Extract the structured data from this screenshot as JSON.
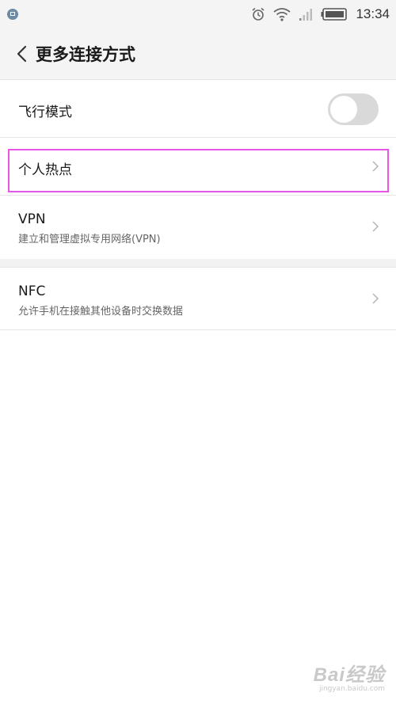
{
  "status_bar": {
    "time": "13:34",
    "icons": [
      "app-notification-icon",
      "alarm-icon",
      "wifi-icon",
      "signal-icon",
      "battery-icon"
    ]
  },
  "header": {
    "back_icon": "chevron-left-icon",
    "title": "更多连接方式"
  },
  "settings": {
    "airplane": {
      "title": "飞行模式",
      "toggle_on": false
    },
    "hotspot": {
      "title": "个人热点"
    },
    "vpn": {
      "title": "VPN",
      "subtitle": "建立和管理虚拟专用网络(VPN)"
    },
    "nfc": {
      "title": "NFC",
      "subtitle": "允许手机在接触其他设备时交换数据"
    }
  },
  "watermark": {
    "main": "Bai经验",
    "url": "jingyan.baidu.com"
  },
  "colors": {
    "background": "#ffffff",
    "header_bg": "#f4f4f4",
    "toggle_off": "#d9d9d9",
    "highlight": "#e455e8"
  }
}
